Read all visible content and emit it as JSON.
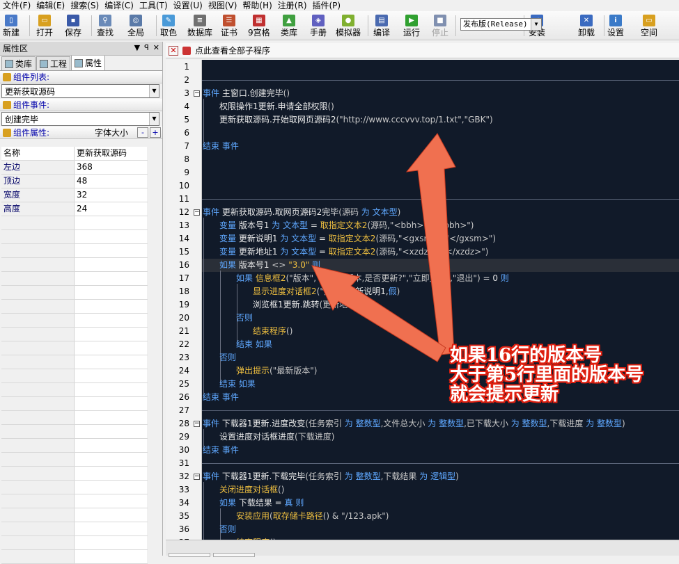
{
  "menu": [
    "文件(F)",
    "编辑(E)",
    "搜索(S)",
    "编译(C)",
    "工具(T)",
    "设置(U)",
    "视图(V)",
    "帮助(H)",
    "注册(R)",
    "插件(P)"
  ],
  "toolbar": {
    "buttons": [
      {
        "label": "新建",
        "icon": "new-file-icon",
        "color": "#4a7ac8"
      },
      {
        "label": "打开",
        "icon": "open-folder-icon",
        "color": "#d8a020"
      },
      {
        "label": "保存",
        "icon": "save-icon",
        "color": "#3a5aa8"
      },
      {
        "label": "查找",
        "icon": "search-icon",
        "color": "#6a8ab8"
      },
      {
        "label": "全局",
        "icon": "global-search-icon",
        "color": "#5a7aa8"
      },
      {
        "label": "取色",
        "icon": "color-picker-icon",
        "color": "#4a9ad8"
      },
      {
        "label": "数据库",
        "icon": "database-icon",
        "color": "#707070"
      },
      {
        "label": "证书",
        "icon": "certificate-icon",
        "color": "#c05030"
      },
      {
        "label": "9宫格",
        "icon": "grid-icon",
        "color": "#c03030"
      },
      {
        "label": "类库",
        "icon": "library-icon",
        "color": "#40a040"
      },
      {
        "label": "手册",
        "icon": "manual-icon",
        "color": "#6060c0"
      },
      {
        "label": "模拟器",
        "icon": "android-icon",
        "color": "#80b030"
      },
      {
        "label": "编译",
        "icon": "compile-icon",
        "color": "#4a6ab0"
      },
      {
        "label": "运行",
        "icon": "run-icon",
        "color": "#30a030"
      },
      {
        "label": "停止",
        "icon": "stop-icon",
        "color": "#8090b0"
      },
      {
        "label": "安装",
        "icon": "install-icon",
        "color": "#3a6ac0"
      },
      {
        "label": "卸载",
        "icon": "uninstall-icon",
        "color": "#3a6ac0"
      },
      {
        "label": "设置",
        "icon": "settings-icon",
        "color": "#3a7ac8"
      },
      {
        "label": "空间",
        "icon": "space-icon",
        "color": "#d8a020"
      }
    ],
    "release_value": "发布版(Release)"
  },
  "left_panel": {
    "title": "属性区",
    "controls": [
      "▼",
      "ꟼ",
      "✕"
    ],
    "tabs": [
      "类库",
      "工程",
      "属性"
    ],
    "component_list_label": "组件列表:",
    "component_selected": "更新获取源码",
    "component_event_label": "组件事件:",
    "event_selected": "创建完毕",
    "component_props_label": "组件属性:",
    "props_sort_label": "字体大小",
    "props": [
      {
        "name": "名称",
        "value": "更新获取源码"
      },
      {
        "name": "左边",
        "value": "368"
      },
      {
        "name": "顶边",
        "value": "48"
      },
      {
        "name": "宽度",
        "value": "32"
      },
      {
        "name": "高度",
        "value": "24"
      }
    ]
  },
  "editor": {
    "header_title": "点此查看全部子程序",
    "lines": [
      {
        "n": "1",
        "html": ""
      },
      {
        "n": "2",
        "html": ""
      },
      {
        "n": "3",
        "html": "<span class='kw'>事件</span> 主窗口.创建完毕<span class='gray'>()</span>"
      },
      {
        "n": "4",
        "html": "权限操作1更新.申请全部权限<span class='gray'>()</span>"
      },
      {
        "n": "5",
        "html": "更新获取源码.开始取网页源码2<span class='gray'>(\"http://www.cccvvv.top/1.txt\",\"GBK\")</span>"
      },
      {
        "n": "6",
        "html": ""
      },
      {
        "n": "7",
        "html": "<span class='kw'>结束 事件</span>"
      },
      {
        "n": "8",
        "html": ""
      },
      {
        "n": "9",
        "html": ""
      },
      {
        "n": "10",
        "html": ""
      },
      {
        "n": "11",
        "html": ""
      },
      {
        "n": "12",
        "html": "<span class='kw'>事件</span> 更新获取源码.取网页源码2完毕<span class='gray'>(源码 <span class='kw'>为 文本型</span>)</span>"
      },
      {
        "n": "13",
        "html": "<span class='kw'>变量</span> 版本号1 <span class='kw'>为 文本型</span> = <span class='gold'>取指定文本2</span><span class='gray'>(源码,\"&lt;bbh&gt;\",\"&lt;/bbh&gt;\")</span>"
      },
      {
        "n": "14",
        "html": "<span class='kw'>变量</span> 更新说明1 <span class='kw'>为 文本型</span> = <span class='gold'>取指定文本2</span><span class='gray'>(源码,\"&lt;gxsm&gt;\",\"&lt;/gxsm&gt;\")</span>"
      },
      {
        "n": "15",
        "html": "<span class='kw'>变量</span> 更新地址1 <span class='kw'>为 文本型</span> = <span class='gold'>取指定文本2</span><span class='gray'>(源码,\"&lt;xzdz&gt;\",\"&lt;/xzdz&gt;\")</span>"
      },
      {
        "n": "16",
        "html": "<span class='kw'>如果</span> 版本号1 <span class='gray'>&lt;&gt;</span> <span class='gold'>\"3.0\"</span> <span class='kw'>则</span>"
      },
      {
        "n": "17",
        "html": "<span class='kw'>如果</span> <span class='gold'>信息框2</span><span class='gray'>(\"版本\",\"发现新版本,是否更新?\",\"立即更新\",\"退出\")</span> = 0 <span class='kw'>则</span>"
      },
      {
        "n": "18",
        "html": "<span class='gold'>显示进度对话框2</span><span class='gray'>(\"更新\",</span>更新说明1,<span class='kw'>假</span><span class='gray'>)</span>"
      },
      {
        "n": "19",
        "html": "浏览框1更新.跳转<span class='gray'>(更新地址1)</span>"
      },
      {
        "n": "20",
        "html": "<span class='kw'>否则</span>"
      },
      {
        "n": "21",
        "html": "<span class='gold'>结束程序</span><span class='gray'>()</span>"
      },
      {
        "n": "22",
        "html": "<span class='kw'>结束 如果</span>"
      },
      {
        "n": "23",
        "html": "<span class='kw'>否则</span>"
      },
      {
        "n": "24",
        "html": "<span class='gold'>弹出提示</span><span class='gray'>(\"最新版本\")</span>"
      },
      {
        "n": "25",
        "html": "<span class='kw'>结束 如果</span>"
      },
      {
        "n": "26",
        "html": "<span class='kw'>结束 事件</span>"
      },
      {
        "n": "27",
        "html": ""
      },
      {
        "n": "28",
        "html": "<span class='kw'>事件</span> 下载器1更新.进度改变<span class='gray'>(任务索引 <span class='kw'>为 整数型</span>,文件总大小 <span class='kw'>为 整数型</span>,已下载大小 <span class='kw'>为 整数型</span>,下载进度 <span class='kw'>为 整数型</span>)</span>"
      },
      {
        "n": "29",
        "html": "设置进度对话框进度<span class='gray'>(下载进度)</span>"
      },
      {
        "n": "30",
        "html": "<span class='kw'>结束 事件</span>"
      },
      {
        "n": "31",
        "html": ""
      },
      {
        "n": "32",
        "html": "<span class='kw'>事件</span> 下载器1更新.下载完毕<span class='gray'>(任务索引 <span class='kw'>为 整数型</span>,下载结果 <span class='kw'>为 逻辑型</span>)</span>"
      },
      {
        "n": "33",
        "html": "<span class='gold'>关闭进度对话框</span><span class='gray'>()</span>"
      },
      {
        "n": "34",
        "html": "<span class='kw'>如果</span> 下载结果 = <span class='kw'>真 则</span>"
      },
      {
        "n": "35",
        "html": "<span class='gold'>安装应用</span><span class='gray'>(</span><span class='gold'>取存储卡路径</span><span class='gray'>() &amp; \"/123.apk\")</span>"
      },
      {
        "n": "36",
        "html": "<span class='kw'>否则</span>"
      },
      {
        "n": "37",
        "html": "<span class='gold'>结束程序</span><span class='gray'>()</span>"
      }
    ]
  },
  "annotation": {
    "lines": [
      "如果16行的版本号",
      "大于第5行里面的版本号",
      "就会提示更新"
    ],
    "color": "#e02010"
  }
}
